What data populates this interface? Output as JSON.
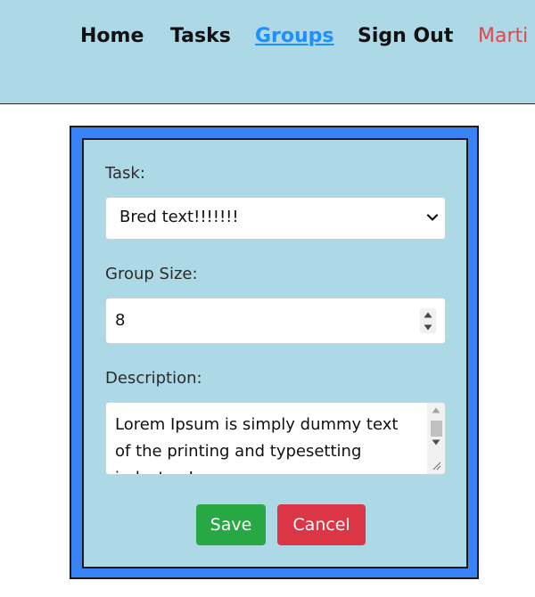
{
  "nav": {
    "home": "Home",
    "tasks": "Tasks",
    "groups": "Groups",
    "sign_out": "Sign Out",
    "user": "Marti"
  },
  "form": {
    "task_label": "Task:",
    "task_selected": "Bred text!!!!!!!",
    "group_size_label": "Group Size:",
    "group_size_value": "8",
    "description_label": "Description:",
    "description_value": "Lorem Ipsum is simply dummy text of the printing and typesetting industry. Lorem",
    "save_label": "Save",
    "cancel_label": "Cancel"
  },
  "colors": {
    "header_bg": "#add8e6",
    "frame_blue": "#3a83f7",
    "active_link": "#1e90ff",
    "user_link": "#e0474c",
    "save_green": "#28a745",
    "cancel_red": "#dc3545"
  },
  "icons": {
    "select_arrow": "chevron-down-icon",
    "stepper": "spin-arrows-icon",
    "resize": "resize-grip-icon"
  }
}
